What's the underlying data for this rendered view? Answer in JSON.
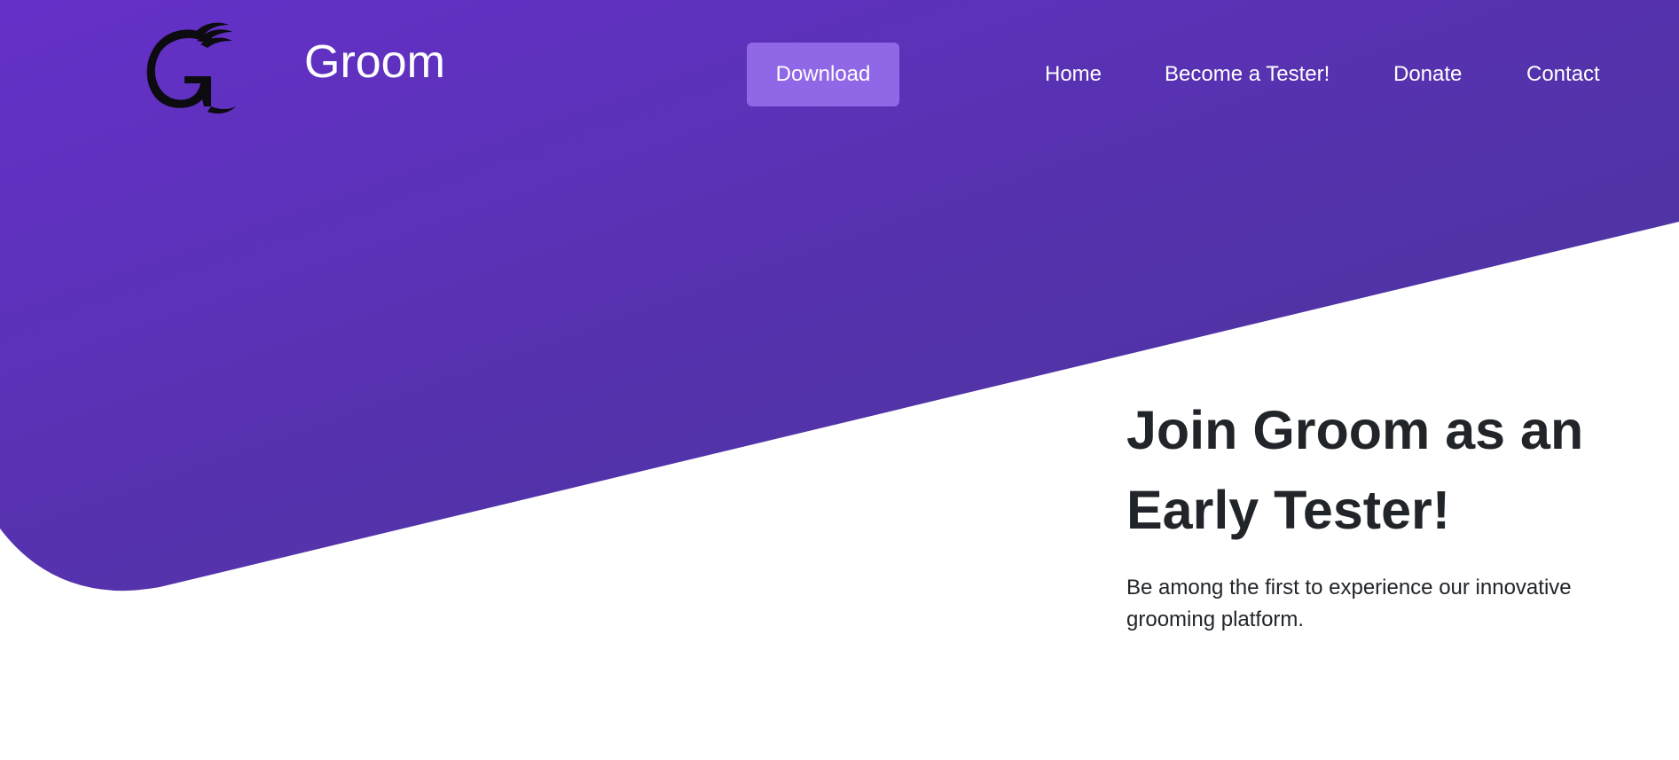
{
  "header": {
    "brand_name": "Groom",
    "logo_icon": "groom-g-logo-icon",
    "download_label": "Download",
    "nav": [
      {
        "label": "Home"
      },
      {
        "label": "Become a Tester!"
      },
      {
        "label": "Donate"
      },
      {
        "label": "Contact"
      }
    ]
  },
  "hero": {
    "headline": "Join Groom as an Early Tester!",
    "subtext": "Be among the first to experience our innovative grooming platform."
  },
  "colors": {
    "gradient_start": "#6530c8",
    "gradient_end": "#4c3598",
    "download_button": "#9067e6",
    "heading_text": "#212529"
  }
}
